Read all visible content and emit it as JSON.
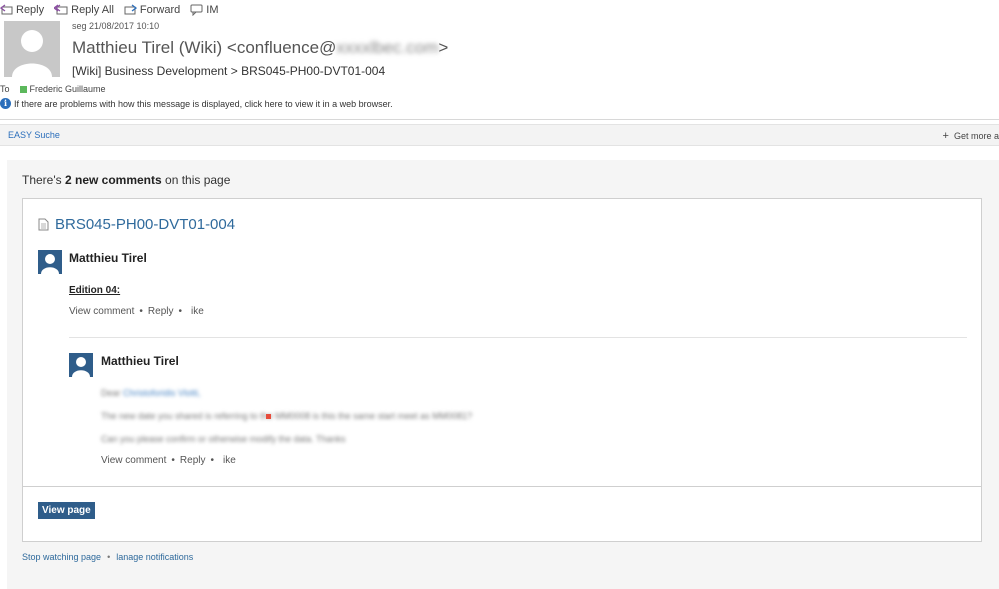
{
  "toolbar": {
    "reply": "Reply",
    "reply_all": "Reply All",
    "forward": "Forward",
    "im": "IM"
  },
  "header": {
    "date": "seg 21/08/2017 10:10",
    "sender_name": "Matthieu Tirel (Wiki) <confluence@",
    "sender_hidden": "xxxxlbec.com",
    "sender_close": ">",
    "subject": "[Wiki] Business Development > BRS045-PH00-DVT01-004",
    "to_label": "To",
    "to_recipient": "Frederic Guillaume",
    "info_text": "If there are problems with how this message is displayed, click here to view it in a web browser."
  },
  "addin_bar": {
    "easy_suche": "EASY Suche",
    "get_more": "Get more a"
  },
  "notification": {
    "intro_prefix": "There's ",
    "intro_count": "2 new comments",
    "intro_suffix": " on this page",
    "page_title": "BRS045-PH00-DVT01-004",
    "comments": [
      {
        "author": "Matthieu Tirel",
        "body_heading": "Edition 04:",
        "view_comment": "View comment",
        "reply": "Reply",
        "like": "ike"
      },
      {
        "author": "Matthieu Tirel",
        "line1_prefix": "Dear",
        "line1_name": "Christoforidis Vlotti,",
        "line2": "The new date you shared is referring to the MM0008 is this the same start meet as MM0081?",
        "line3": "Can you please confirm or otherwise modify the data. Thanks",
        "view_comment": "View comment",
        "reply": "Reply",
        "like": "ike"
      }
    ],
    "dot": "•",
    "view_page": "View page",
    "stop_watching": "Stop watching page",
    "manage_notifications": "lanage notifications"
  },
  "colors": {
    "link_blue": "#2f6a9c",
    "avatar_blue": "#2f5d8a",
    "status_green": "#5cb85c"
  }
}
